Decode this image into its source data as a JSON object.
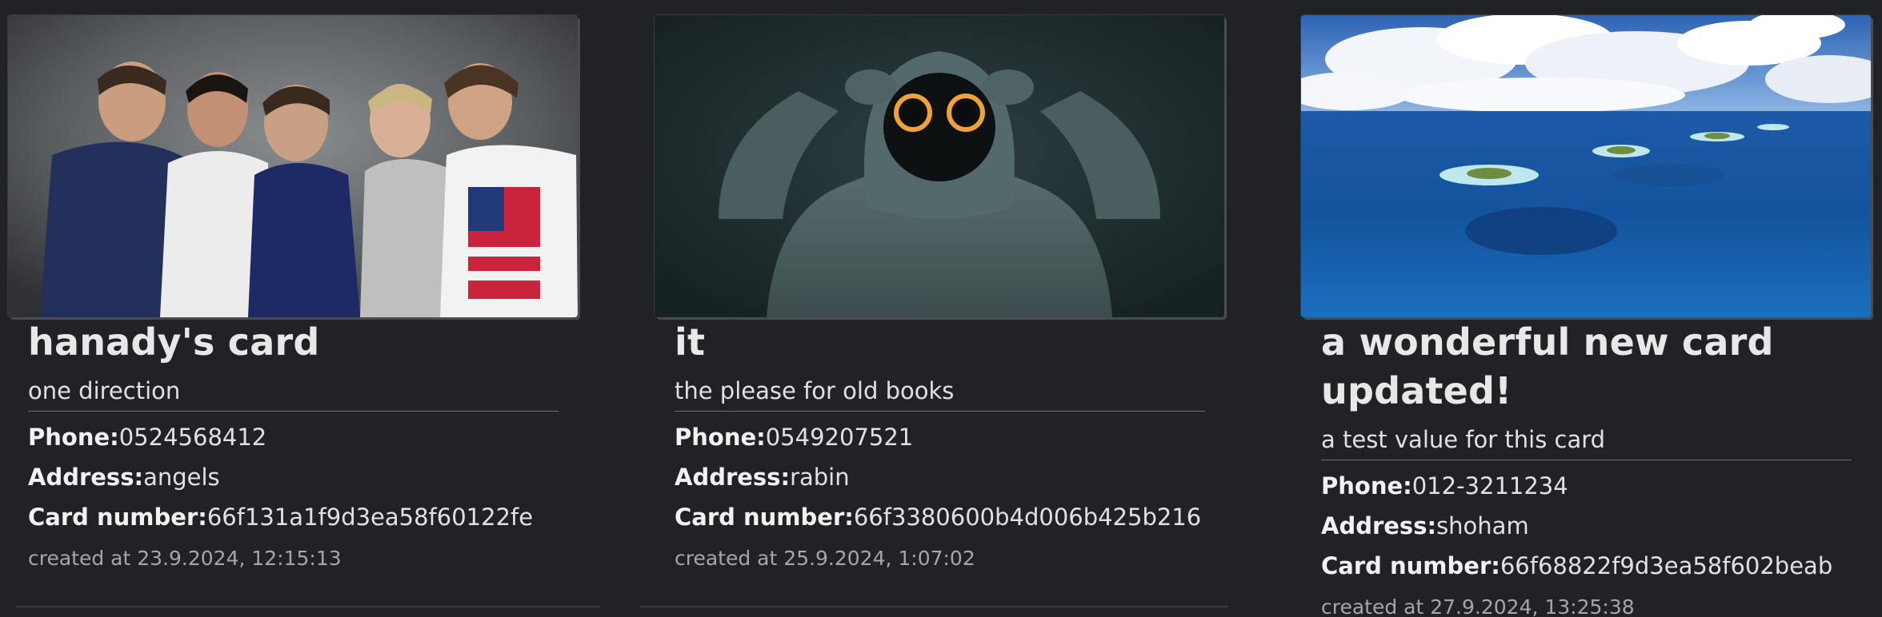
{
  "cards": [
    {
      "title": "hanady's card",
      "subtitle": "one direction",
      "phone_label": "Phone:",
      "phone": "0524568412",
      "address_label": "Address:",
      "address": "angels",
      "card_number_label": "Card number:",
      "card_number": "66f131a1f9d3ea58f60122fe",
      "created": "created at 23.9.2024, 12:15:13",
      "image": "photo-of-band"
    },
    {
      "title": "it",
      "subtitle": "the please for old books",
      "phone_label": "Phone:",
      "phone": "0549207521",
      "address_label": "Address:",
      "address": "rabin",
      "card_number_label": "Card number:",
      "card_number": "66f3380600b4d006b425b216",
      "created": "created at 25.9.2024, 1:07:02",
      "image": "hooded-figure-glowing-eyes"
    },
    {
      "title": "a wonderful new card updated!",
      "subtitle": "a test value for this card",
      "phone_label": "Phone:",
      "phone": "012-3211234",
      "address_label": "Address:",
      "address": "shoham",
      "card_number_label": "Card number:",
      "card_number": "66f68822f9d3ea58f602beab",
      "created": "created at 27.9.2024, 13:25:38",
      "image": "ocean-islands-aerial"
    }
  ],
  "colors": {
    "background": "#212226",
    "text": "#dfe2e5",
    "muted": "#a3a7ad"
  }
}
